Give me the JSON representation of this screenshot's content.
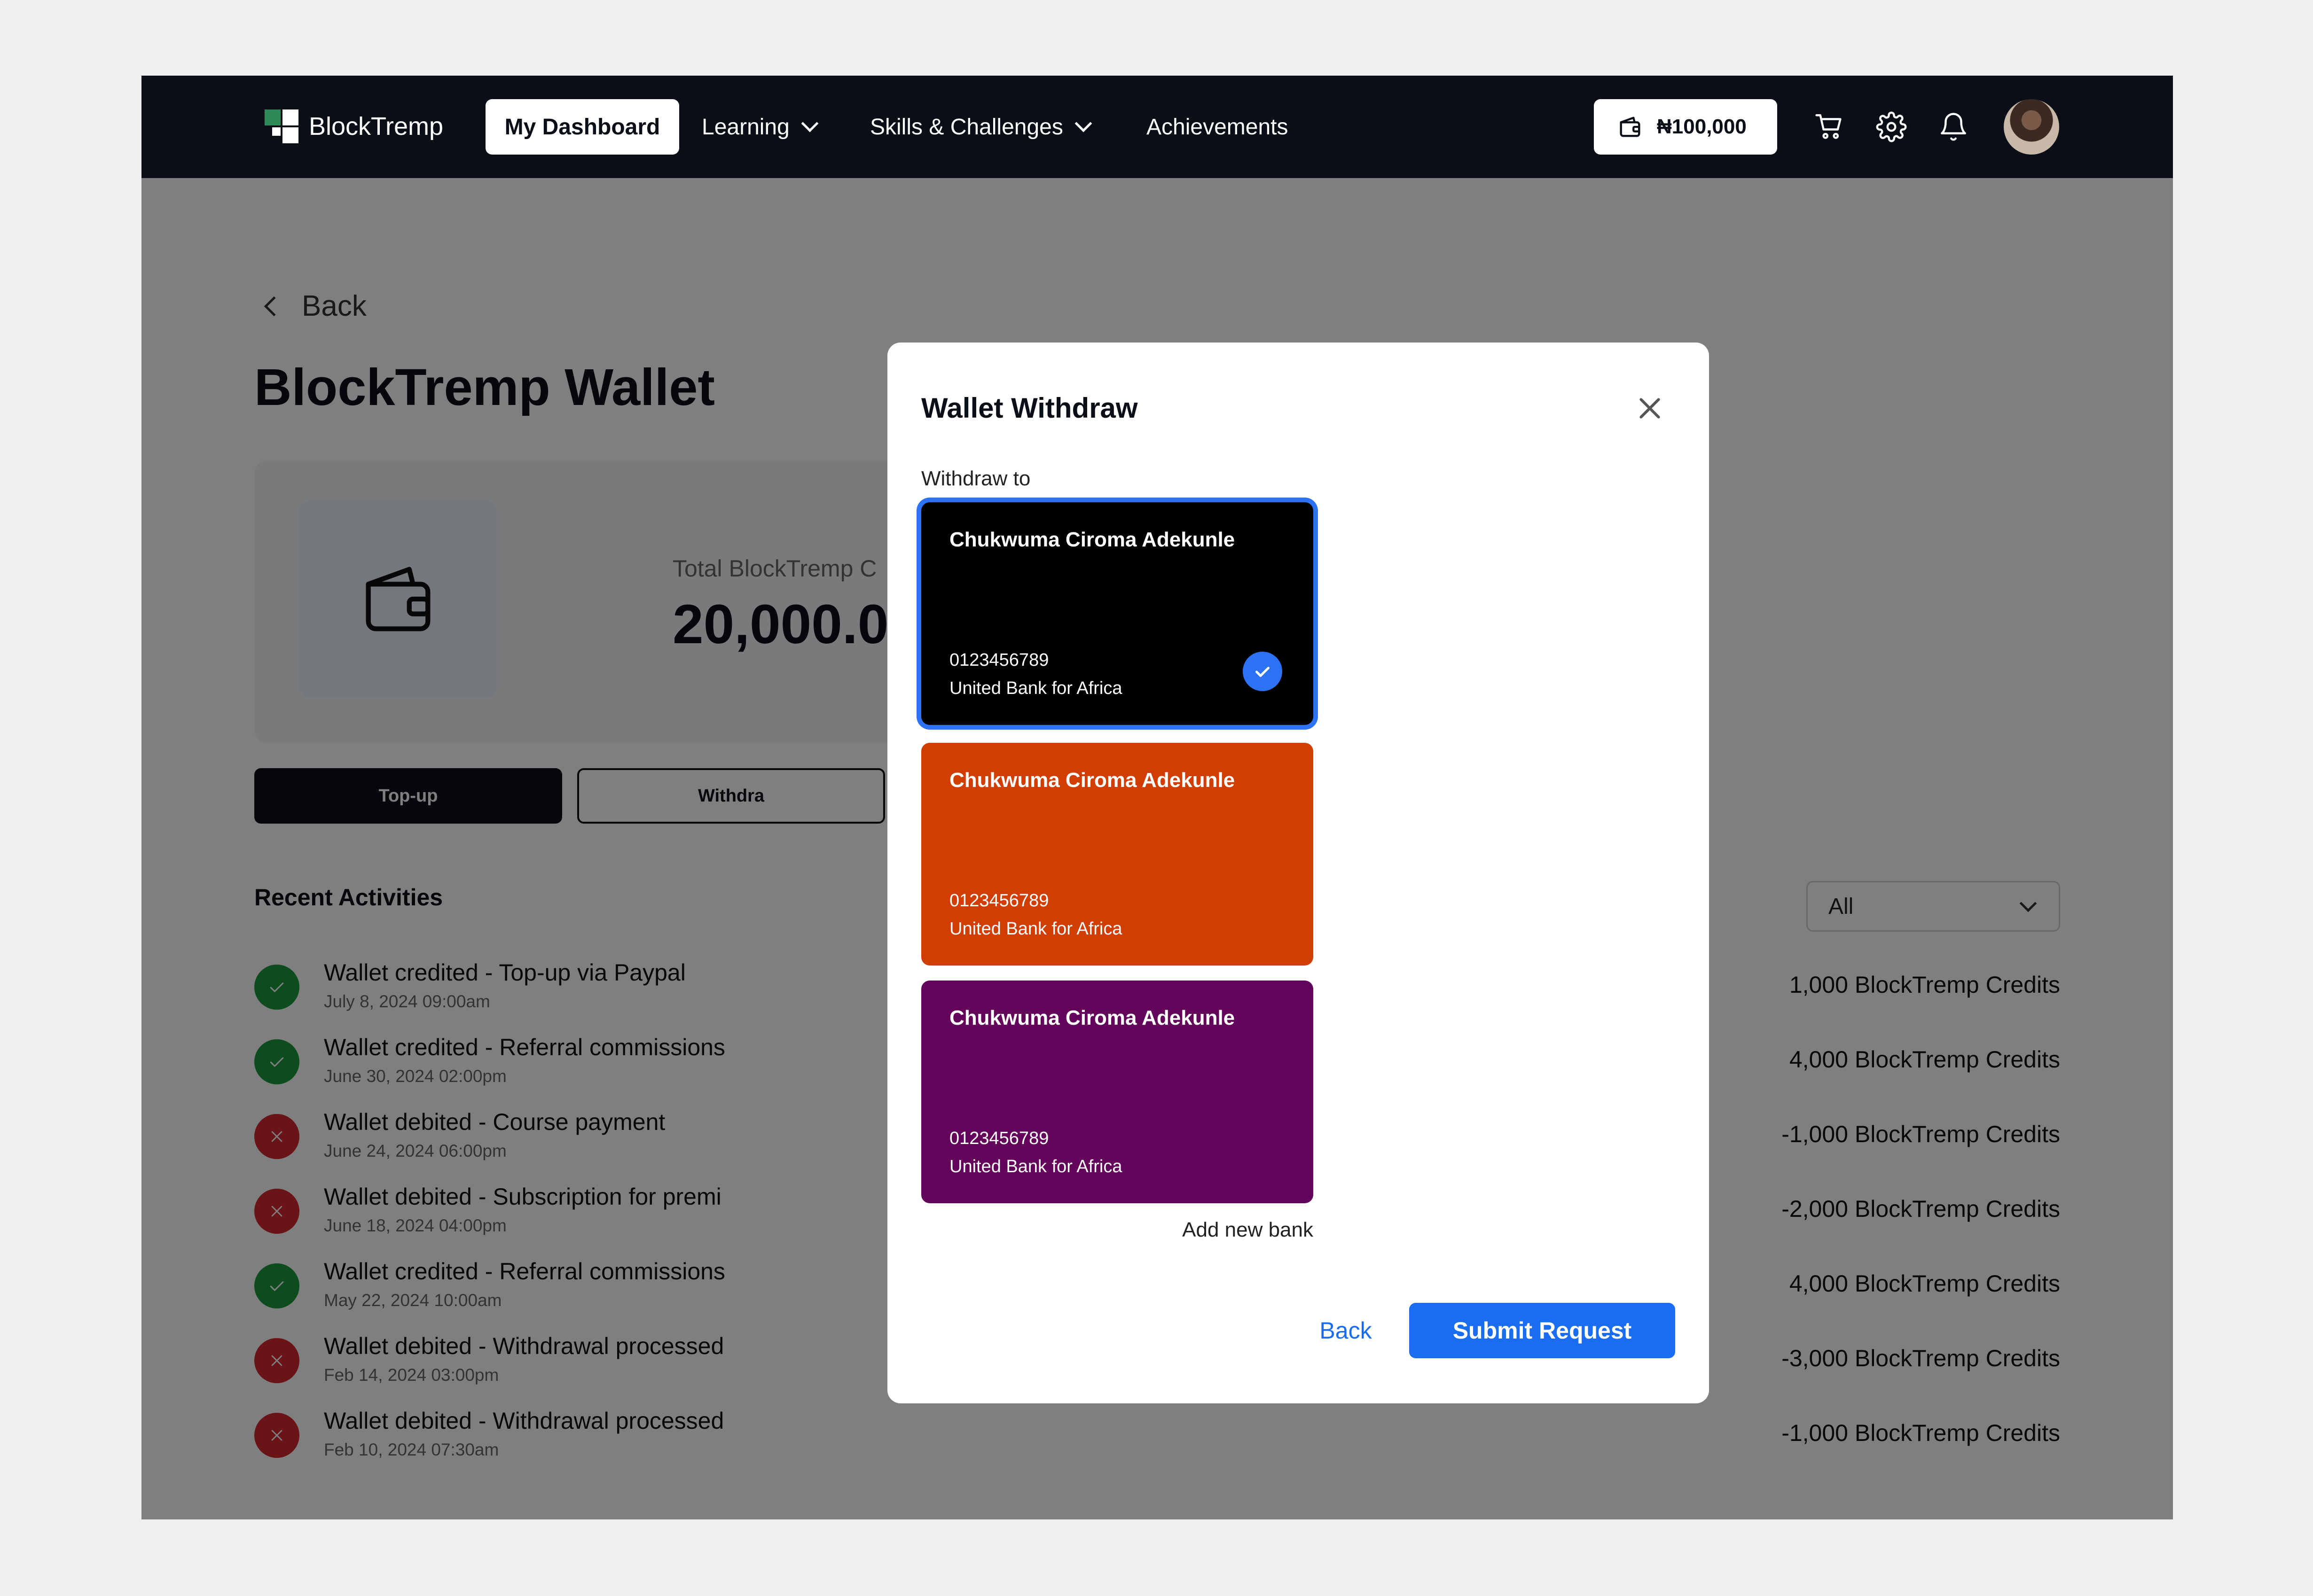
{
  "nav": {
    "logo_text": "BlockTremp",
    "dashboard": "My Dashboard",
    "learning": "Learning",
    "skills": "Skills & Challenges",
    "achievements": "Achievements",
    "wallet_balance": "₦100,000",
    "icons": [
      "wallet-icon",
      "cart-icon",
      "gear-icon",
      "bell-icon"
    ]
  },
  "page": {
    "back": "Back",
    "title": "BlockTremp Wallet",
    "balance_label": "Total BlockTremp C",
    "balance_value": "20,000.0",
    "topup": "Top-up",
    "withdraw": "Withdra",
    "recent_title": "Recent Activities",
    "filter_value": "All"
  },
  "activities": [
    {
      "status": "success",
      "title": "Wallet credited - Top-up via Paypal",
      "date": "July 8, 2024 09:00am",
      "amount": "1,000 BlockTremp Credits"
    },
    {
      "status": "success",
      "title": "Wallet credited - Referral commissions",
      "date": "June 30, 2024 02:00pm",
      "amount": "4,000 BlockTremp Credits"
    },
    {
      "status": "failed",
      "title": "Wallet debited - Course payment",
      "date": "June 24, 2024 06:00pm",
      "amount": "-1,000 BlockTremp Credits"
    },
    {
      "status": "failed",
      "title": "Wallet debited - Subscription for premi",
      "date": "June 18, 2024 04:00pm",
      "amount": "-2,000 BlockTremp Credits"
    },
    {
      "status": "success",
      "title": "Wallet credited - Referral commissions",
      "date": "May 22, 2024 10:00am",
      "amount": "4,000 BlockTremp Credits"
    },
    {
      "status": "failed",
      "title": "Wallet debited - Withdrawal processed",
      "date": "Feb 14, 2024 03:00pm",
      "amount": "-3,000 BlockTremp Credits"
    },
    {
      "status": "failed",
      "title": "Wallet debited - Withdrawal processed",
      "date": "Feb 10, 2024 07:30am",
      "amount": "-1,000 BlockTremp Credits"
    }
  ],
  "modal": {
    "title": "Wallet Withdraw",
    "withdraw_to": "Withdraw to",
    "cards": [
      {
        "name": "Chukwuma Ciroma Adekunle",
        "account": "0123456789",
        "bank": "United Bank for Africa",
        "color": "#000000",
        "selected": true
      },
      {
        "name": "Chukwuma Ciroma Adekunle",
        "account": "0123456789",
        "bank": "United Bank for Africa",
        "color": "#d03e03",
        "selected": false
      },
      {
        "name": "Chukwuma Ciroma Adekunle",
        "account": "0123456789",
        "bank": "United Bank for Africa",
        "color": "#64035a",
        "selected": false
      }
    ],
    "add_bank": "Add new bank",
    "back": "Back",
    "submit": "Submit Request"
  },
  "colors": {
    "nav_bg": "#0a0e16",
    "primary": "#1a6cf0",
    "success": "#1a9a3a",
    "danger": "#d3292f"
  }
}
